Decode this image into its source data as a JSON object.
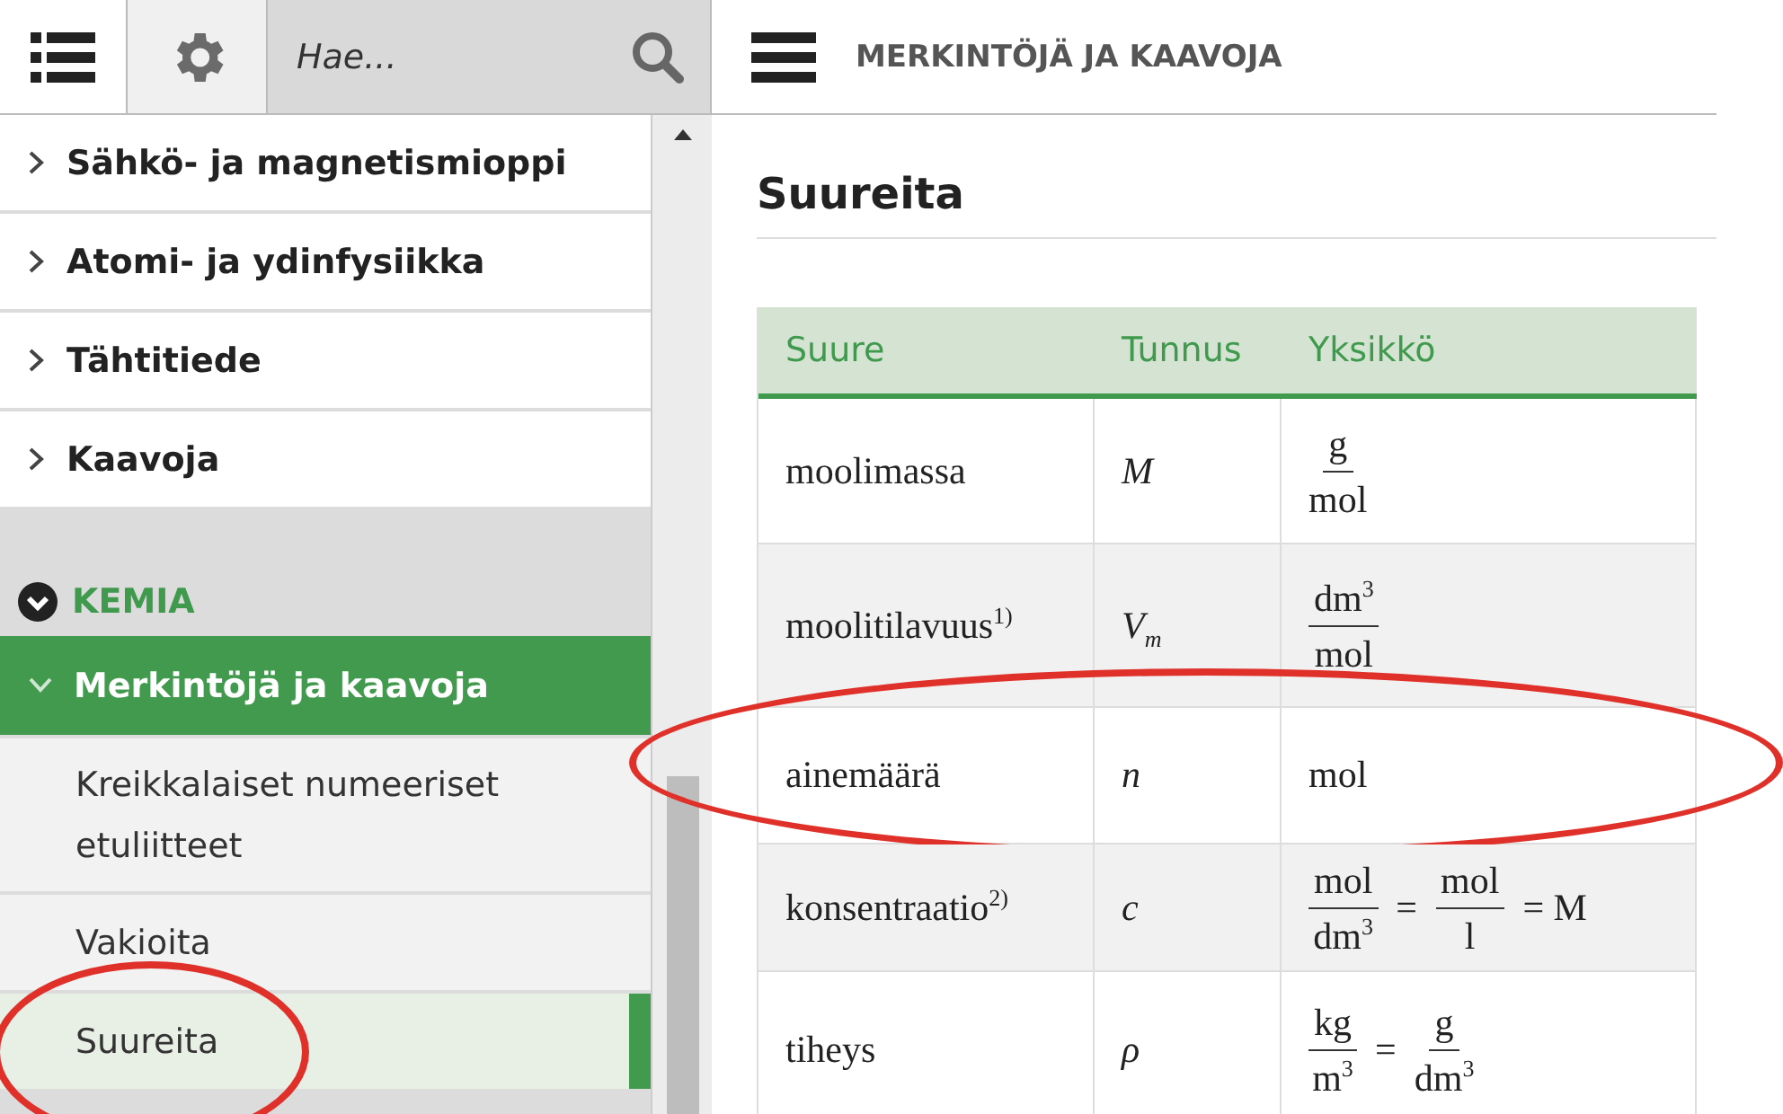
{
  "toolbar": {
    "search": {
      "placeholder": "Hae..."
    }
  },
  "header": {
    "title": "MERKINTÖJÄ JA KAAVOJA"
  },
  "sidebar": {
    "items": [
      {
        "label": "Sähkö- ja magnetismioppi",
        "expanded": false
      },
      {
        "label": "Atomi- ja ydinfysiikka",
        "expanded": false
      },
      {
        "label": "Tähtitiede",
        "expanded": false
      },
      {
        "label": "Kaavoja",
        "expanded": false
      }
    ],
    "section": {
      "label": "KEMIA",
      "expanded": true,
      "group": {
        "label": "Merkintöjä ja kaavoja",
        "expanded": true,
        "children": [
          {
            "label": "Kreikkalaiset numeeriset etuliitteet",
            "selected": false,
            "circled": false
          },
          {
            "label": "Vakioita",
            "selected": false,
            "circled": false
          },
          {
            "label": "Suureita",
            "selected": true,
            "circled": true
          }
        ]
      }
    }
  },
  "content": {
    "heading": "Suureita",
    "table": {
      "columns": [
        "Suure",
        "Tunnus",
        "Yksikkö"
      ],
      "rows": [
        {
          "quantity": "moolimassa",
          "symbol": "M",
          "circled": false,
          "unit": [
            {
              "kind": "fraction",
              "num": "g",
              "den": "mol"
            }
          ]
        },
        {
          "quantity": "moolitilavuus$^{1)}$",
          "symbol": "V$_{m}$",
          "circled": false,
          "unit": [
            {
              "kind": "fraction",
              "num": "dm$^{3}$",
              "den": "mol"
            }
          ]
        },
        {
          "quantity": "ainemäärä",
          "symbol": "n",
          "circled": true,
          "unit": [
            {
              "kind": "text",
              "text": "mol"
            }
          ]
        },
        {
          "quantity": "konsentraatio$^{2)}$",
          "symbol": "c",
          "circled": false,
          "unit": [
            {
              "kind": "fraction",
              "num": "mol",
              "den": "dm$^{3}$"
            },
            {
              "kind": "text",
              "text": "="
            },
            {
              "kind": "fraction",
              "num": "mol",
              "den": "l"
            },
            {
              "kind": "text",
              "text": "= M"
            }
          ]
        },
        {
          "quantity": "tiheys",
          "symbol": "ρ",
          "circled": false,
          "unit": [
            {
              "kind": "fraction",
              "num": "kg",
              "den": "m$^{3}$"
            },
            {
              "kind": "text",
              "text": "="
            },
            {
              "kind": "fraction",
              "num": "g",
              "den": "dm$^{3}$"
            }
          ]
        }
      ]
    }
  }
}
